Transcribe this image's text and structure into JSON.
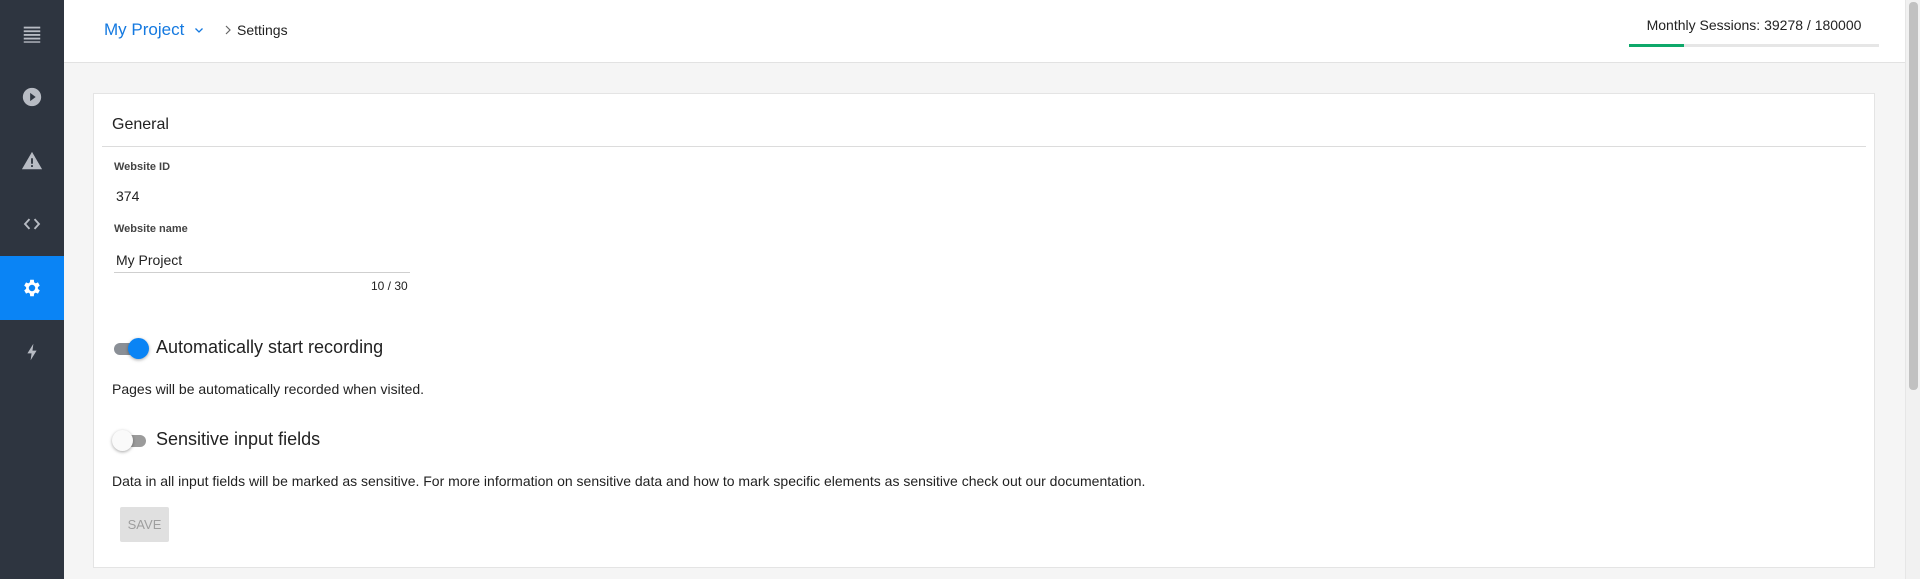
{
  "sidebar": {
    "items": [
      {
        "icon": "menu-icon",
        "active": false
      },
      {
        "icon": "play-icon",
        "active": false
      },
      {
        "icon": "warning-icon",
        "active": false
      },
      {
        "icon": "code-icon",
        "active": false
      },
      {
        "icon": "gear-icon",
        "active": true
      },
      {
        "icon": "bolt-icon",
        "active": false
      }
    ],
    "active_color": "#0a84f5"
  },
  "header": {
    "project_name": "My Project",
    "breadcrumb": "Settings",
    "sessions_label": "Monthly Sessions: 39278 / 180000",
    "sessions_used": 39278,
    "sessions_limit": 180000,
    "progress_color": "#0fa86a"
  },
  "general": {
    "title": "General",
    "website_id_label": "Website ID",
    "website_id": "374",
    "website_name_label": "Website name",
    "website_name": "My Project",
    "name_counter": "10 / 30"
  },
  "recording": {
    "label": "Automatically start recording",
    "enabled": true,
    "description": "Pages will be automatically recorded when visited."
  },
  "sensitive": {
    "label": "Sensitive input fields",
    "enabled": false,
    "description": "Data in all input fields will be marked as sensitive. For more information on sensitive data and how to mark specific elements as sensitive check out our documentation."
  },
  "save_label": "SAVE"
}
